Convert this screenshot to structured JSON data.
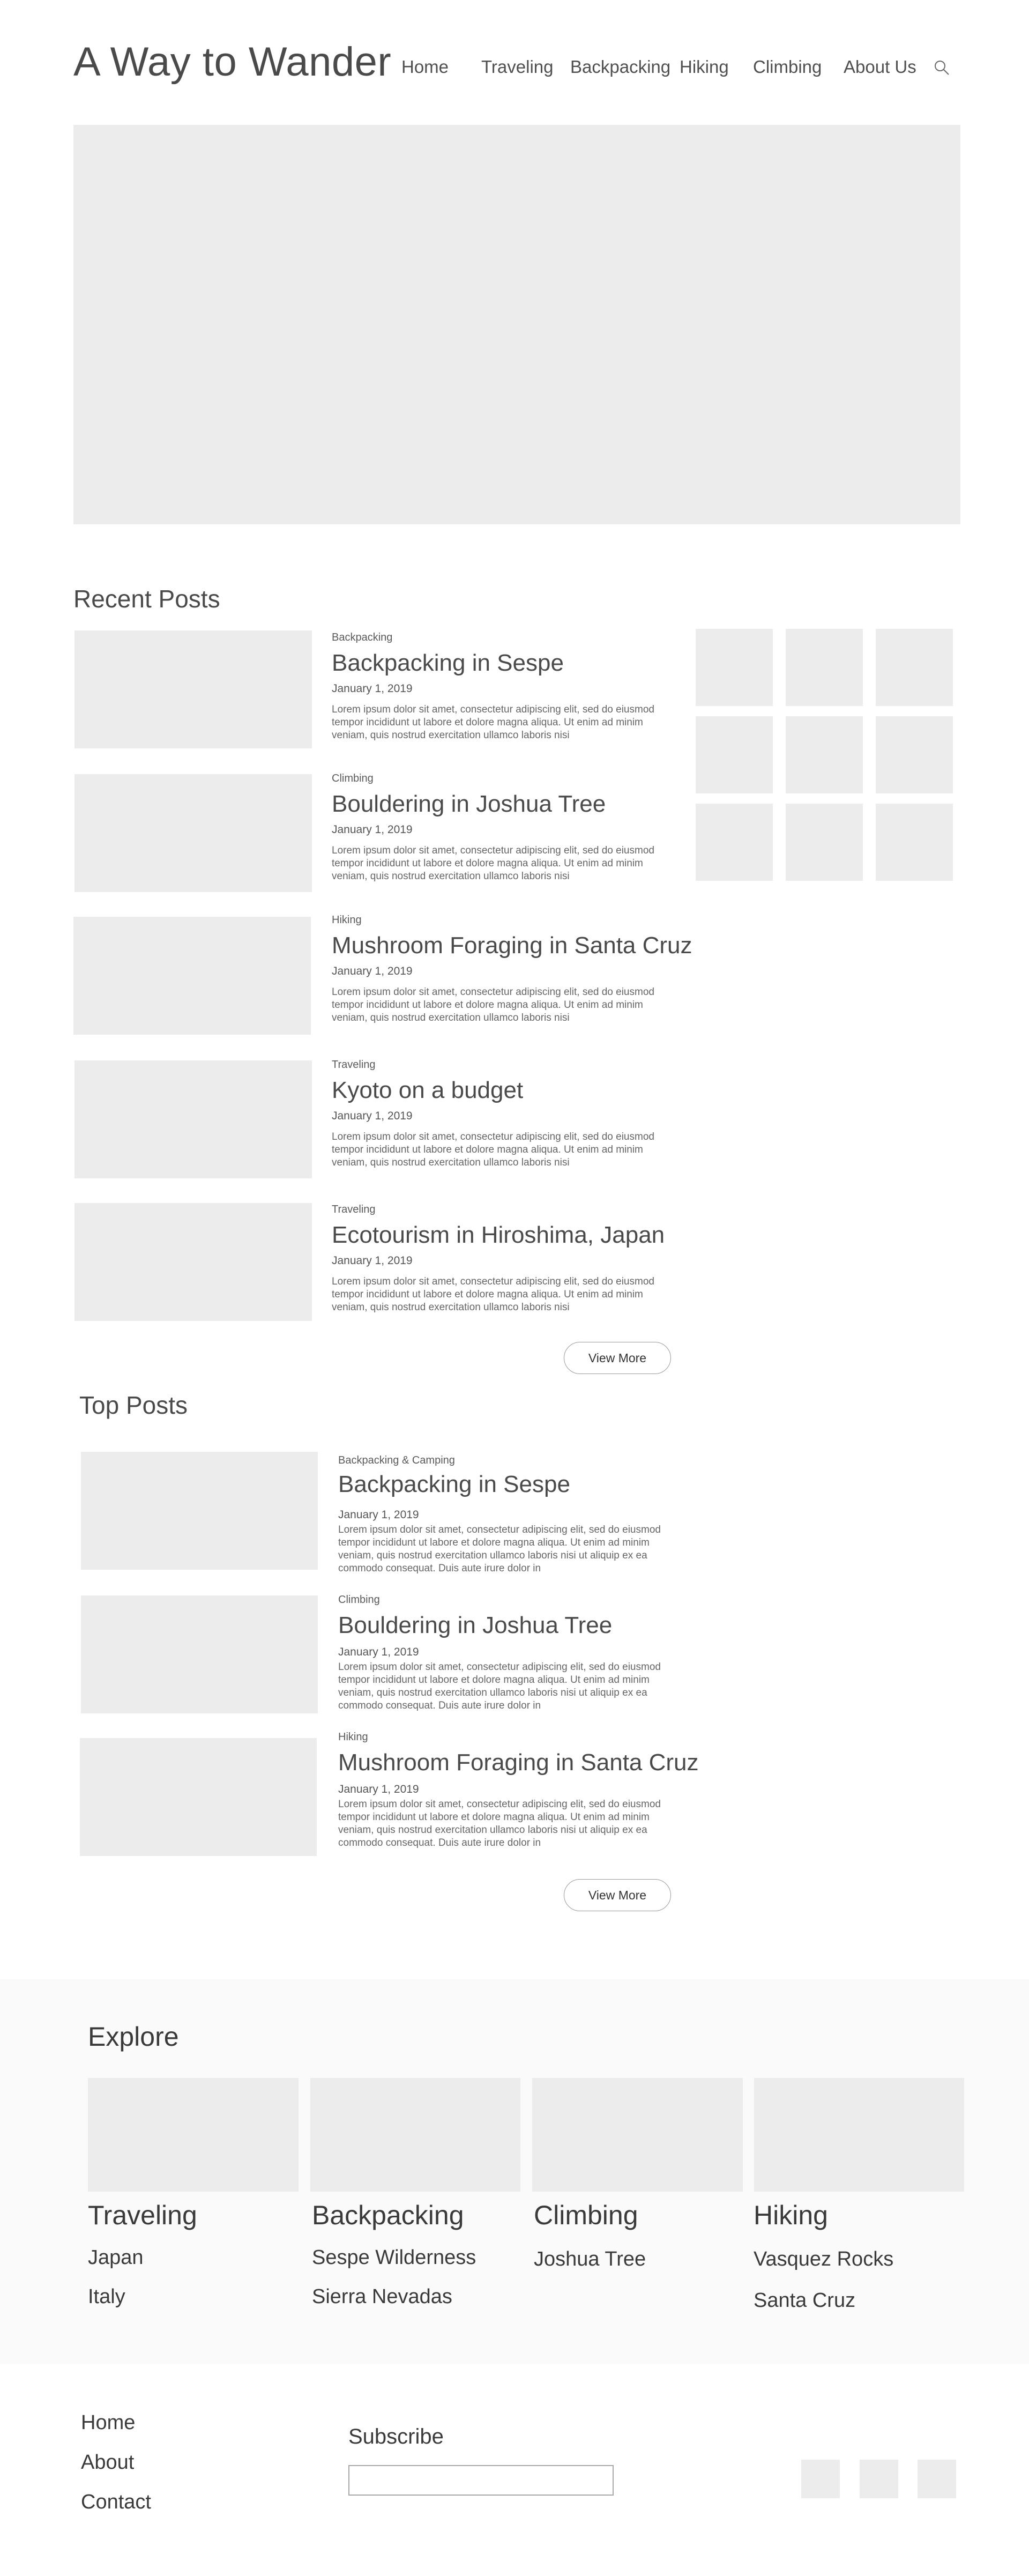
{
  "site": {
    "title": "A Way to Wander"
  },
  "nav": {
    "items": [
      {
        "label": "Home"
      },
      {
        "label": "Traveling"
      },
      {
        "label": "Backpacking"
      },
      {
        "label": "Hiking"
      },
      {
        "label": "Climbing"
      },
      {
        "label": "About Us"
      }
    ],
    "search_icon": "search-icon"
  },
  "recent": {
    "title": "Recent Posts",
    "posts": [
      {
        "category": "Backpacking",
        "title": "Backpacking in Sespe",
        "date": "January 1, 2019",
        "excerpt": "Lorem ipsum dolor sit amet, consectetur adipiscing elit, sed do eiusmod tempor incididunt ut labore et dolore magna aliqua. Ut enim ad minim veniam, quis nostrud exercitation ullamco laboris nisi"
      },
      {
        "category": "Climbing",
        "title": "Bouldering in Joshua Tree",
        "date": "January 1, 2019",
        "excerpt": "Lorem ipsum dolor sit amet, consectetur adipiscing elit, sed do eiusmod tempor incididunt ut labore et dolore magna aliqua. Ut enim ad minim veniam, quis nostrud exercitation ullamco laboris nisi"
      },
      {
        "category": "Hiking",
        "title": "Mushroom Foraging in Santa Cruz",
        "date": "January 1, 2019",
        "excerpt": "Lorem ipsum dolor sit amet, consectetur adipiscing elit, sed do eiusmod tempor incididunt ut labore et dolore magna aliqua. Ut enim ad minim veniam, quis nostrud exercitation ullamco laboris nisi"
      },
      {
        "category": "Traveling",
        "title": "Kyoto on a budget",
        "date": "January 1, 2019",
        "excerpt": "Lorem ipsum dolor sit amet, consectetur adipiscing elit, sed do eiusmod tempor incididunt ut labore et dolore magna aliqua. Ut enim ad minim veniam, quis nostrud exercitation ullamco laboris nisi"
      },
      {
        "category": "Traveling",
        "title": "Ecotourism in Hiroshima, Japan",
        "date": "January 1, 2019",
        "excerpt": "Lorem ipsum dolor sit amet, consectetur adipiscing elit, sed do eiusmod tempor incididunt ut labore et dolore magna aliqua. Ut enim ad minim veniam, quis nostrud exercitation ullamco laboris nisi"
      }
    ],
    "view_more": "View More"
  },
  "top": {
    "title": "Top Posts",
    "posts": [
      {
        "category": "Backpacking & Camping",
        "title": "Backpacking in Sespe",
        "date": "January 1, 2019",
        "excerpt": "Lorem ipsum dolor sit amet, consectetur adipiscing elit, sed do eiusmod tempor incididunt ut labore et dolore magna aliqua. Ut enim ad minim veniam, quis nostrud exercitation ullamco laboris nisi ut aliquip ex ea commodo consequat. Duis aute irure dolor in"
      },
      {
        "category": "Climbing",
        "title": "Bouldering in Joshua Tree",
        "date": "January 1, 2019",
        "excerpt": "Lorem ipsum dolor sit amet, consectetur adipiscing elit, sed do eiusmod tempor incididunt ut labore et dolore magna aliqua. Ut enim ad minim veniam, quis nostrud exercitation ullamco laboris nisi ut aliquip ex ea commodo consequat. Duis aute irure dolor in"
      },
      {
        "category": "Hiking",
        "title": "Mushroom Foraging in Santa Cruz",
        "date": "January 1, 2019",
        "excerpt": "Lorem ipsum dolor sit amet, consectetur adipiscing elit, sed do eiusmod tempor incididunt ut labore et dolore magna aliqua. Ut enim ad minim veniam, quis nostrud exercitation ullamco laboris nisi ut aliquip ex ea commodo consequat. Duis aute irure dolor in"
      }
    ],
    "view_more": "View More"
  },
  "explore": {
    "title": "Explore",
    "columns": [
      {
        "heading": "Traveling",
        "links": [
          "Japan",
          "Italy"
        ]
      },
      {
        "heading": "Backpacking",
        "links": [
          "Sespe Wilderness",
          "Sierra Nevadas"
        ]
      },
      {
        "heading": "Climbing",
        "links": [
          "Joshua Tree"
        ]
      },
      {
        "heading": "Hiking",
        "links": [
          "Vasquez Rocks",
          "Santa Cruz"
        ]
      }
    ]
  },
  "footer": {
    "links": [
      {
        "label": "Home"
      },
      {
        "label": "About"
      },
      {
        "label": "Contact"
      }
    ],
    "subscribe": {
      "label": "Subscribe",
      "value": "",
      "placeholder": ""
    }
  },
  "colors": {
    "placeholder": "#ececec",
    "text": "#4a4a4a",
    "band": "#fafafa"
  }
}
